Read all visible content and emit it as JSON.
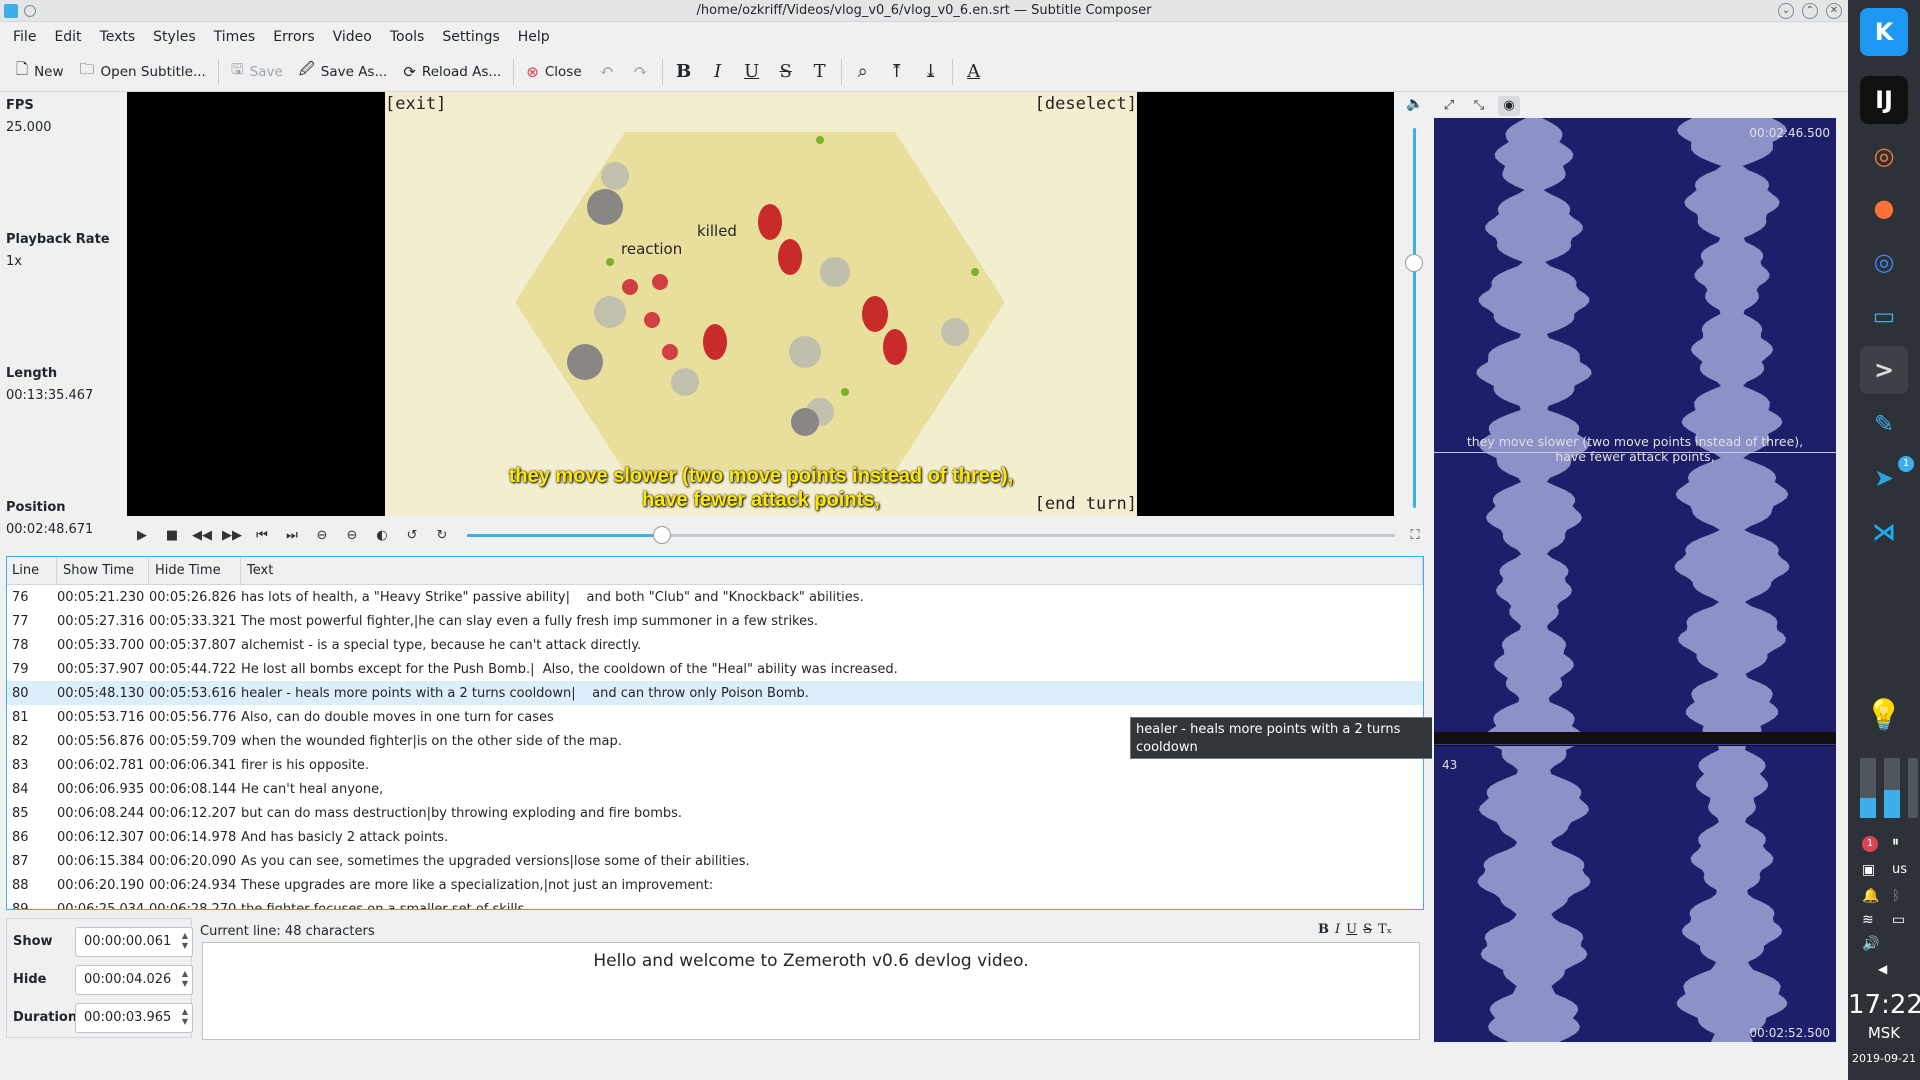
{
  "window": {
    "title": "/home/ozkriff/Videos/vlog_v0_6/vlog_v0_6.en.srt — Subtitle Composer",
    "buttons": [
      "⌄",
      "⌃",
      "✕"
    ]
  },
  "menu": [
    "File",
    "Edit",
    "Texts",
    "Styles",
    "Times",
    "Errors",
    "Video",
    "Tools",
    "Settings",
    "Help"
  ],
  "toolbar": {
    "new": "New",
    "open": "Open Subtitle...",
    "save": "Save",
    "save_as": "Save As...",
    "reload": "Reload As...",
    "close": "Close"
  },
  "info": {
    "fps_label": "FPS",
    "fps_value": "25.000",
    "rate_label": "Playback Rate",
    "rate_value": "1x",
    "length_label": "Length",
    "length_value": "00:13:35.467",
    "position_label": "Position",
    "position_value": "00:02:48.671"
  },
  "video": {
    "exit": "[exit]",
    "deselect": "[deselect]",
    "end_turn": "[end turn]",
    "label_killed": "killed",
    "label_reaction": "reaction",
    "subtitle_1": "they move slower (two move points instead of three),",
    "subtitle_2": "have fewer attack points,",
    "seek_fraction": 0.21
  },
  "table": {
    "headers": [
      "Line",
      "Show Time",
      "Hide Time",
      "Text"
    ],
    "rows": [
      {
        "line": "76",
        "show": "00:05:21.230",
        "hide": "00:05:26.826",
        "text": "has lots of health, a \"Heavy Strike\" passive ability|    and both \"Club\" and \"Knockback\" abilities."
      },
      {
        "line": "77",
        "show": "00:05:27.316",
        "hide": "00:05:33.321",
        "text": "The most powerful fighter,|he can slay even a fully fresh imp summoner in a few strikes."
      },
      {
        "line": "78",
        "show": "00:05:33.700",
        "hide": "00:05:37.807",
        "text": "alchemist - is a special type, because he can't attack directly."
      },
      {
        "line": "79",
        "show": "00:05:37.907",
        "hide": "00:05:44.722",
        "text": "He lost all bombs except for the Push Bomb.|  Also, the cooldown of the \"Heal\" ability was increased."
      },
      {
        "line": "80",
        "show": "00:05:48.130",
        "hide": "00:05:53.616",
        "text": "healer - heals more points with a 2 turns cooldown|    and can throw only Poison Bomb."
      },
      {
        "line": "81",
        "show": "00:05:53.716",
        "hide": "00:05:56.776",
        "text": "Also, can do double moves in one turn for cases"
      },
      {
        "line": "82",
        "show": "00:05:56.876",
        "hide": "00:05:59.709",
        "text": "when the wounded fighter|is on the other side of the map."
      },
      {
        "line": "83",
        "show": "00:06:02.781",
        "hide": "00:06:06.341",
        "text": "firer is his opposite."
      },
      {
        "line": "84",
        "show": "00:06:06.935",
        "hide": "00:06:08.144",
        "text": "He can't heal anyone,"
      },
      {
        "line": "85",
        "show": "00:06:08.244",
        "hide": "00:06:12.207",
        "text": "but can do mass destruction|by throwing exploding and fire bombs."
      },
      {
        "line": "86",
        "show": "00:06:12.307",
        "hide": "00:06:14.978",
        "text": "And has basicly 2 attack points."
      },
      {
        "line": "87",
        "show": "00:06:15.384",
        "hide": "00:06:20.090",
        "text": "As you can see, sometimes the upgraded versions|lose some of their abilities."
      },
      {
        "line": "88",
        "show": "00:06:20.190",
        "hide": "00:06:24.934",
        "text": "These upgrades are more like a specialization,|not just an improvement:"
      },
      {
        "line": "89",
        "show": "00:06:25.034",
        "hide": "00:06:28.270",
        "text": "the fighter focuses on a smaller set of skills."
      }
    ],
    "selected_line": "80"
  },
  "tooltip": {
    "line1": "healer - heals more points with a 2 turns cooldown",
    "line2": "  and can throw only Poison Bomb."
  },
  "editor": {
    "show_label": "Show",
    "show_value": "00:00:00.061",
    "hide_label": "Hide",
    "hide_value": "00:00:04.026",
    "duration_label": "Duration",
    "duration_value": "00:00:03.965",
    "current_line": "Current line: 48 characters",
    "text": "Hello and welcome to Zemeroth v0.6 devlog video.",
    "format_buttons": [
      "B",
      "I",
      "U",
      "S",
      "Tₓ"
    ]
  },
  "waveform": {
    "time_top": "00:02:46.500",
    "time_bottom": "00:02:52.500",
    "subtitle_1": "they move slower (two move points instead of three),",
    "subtitle_2": "have fewer attack points,",
    "marker": "43"
  },
  "panel": {
    "kbd": "us",
    "notif_count": "1",
    "telegram_count": "1",
    "time": "17:22",
    "tz": "MSK",
    "date": "2019-09-21"
  },
  "colors": {
    "accent": "#3daee9",
    "subtitle": "#ffe900",
    "waveform_bg": "#1d1f6a",
    "selection": "#dceefa"
  }
}
